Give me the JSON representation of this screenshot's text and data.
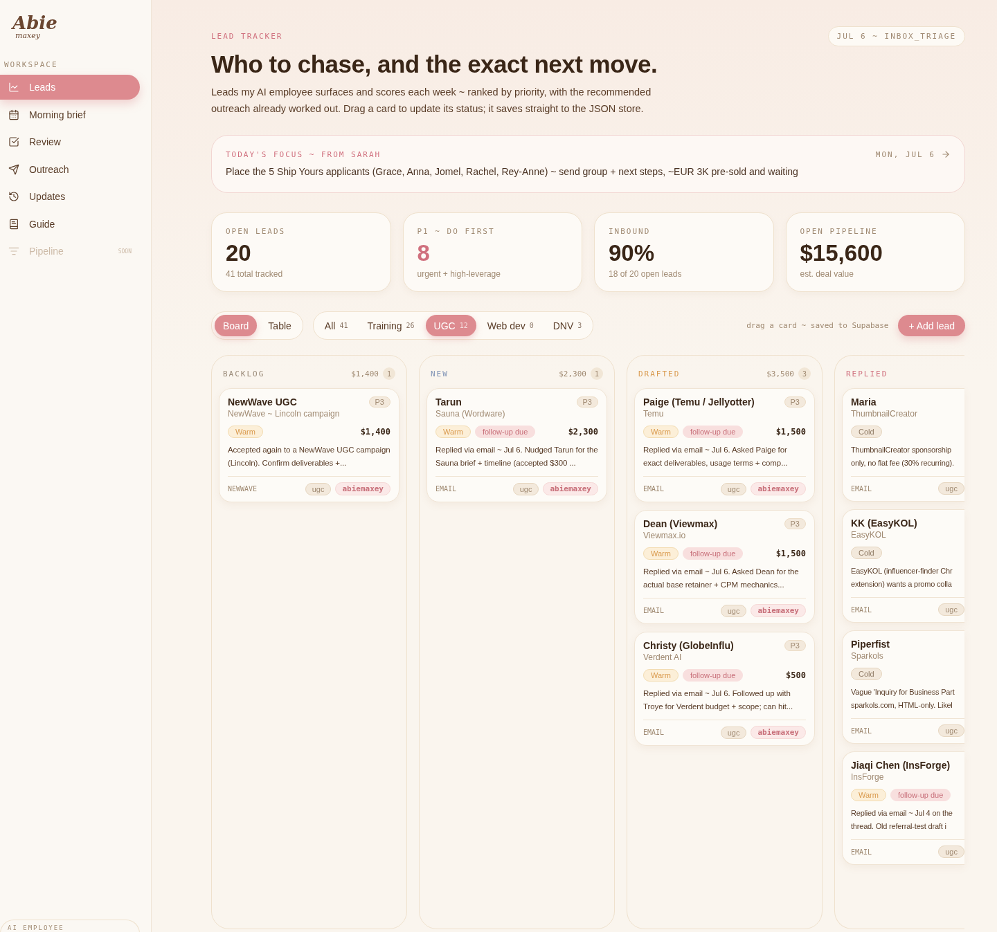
{
  "logo": {
    "title": "Abie",
    "subtitle": "maxey"
  },
  "sidebar": {
    "section": "WORKSPACE",
    "items": [
      {
        "label": "Leads",
        "selected": true,
        "disabled": false
      },
      {
        "label": "Morning brief",
        "selected": false,
        "disabled": false
      },
      {
        "label": "Review",
        "selected": false,
        "disabled": false
      },
      {
        "label": "Outreach",
        "selected": false,
        "disabled": false
      },
      {
        "label": "Updates",
        "selected": false,
        "disabled": false
      },
      {
        "label": "Guide",
        "selected": false,
        "disabled": false
      },
      {
        "label": "Pipeline",
        "selected": false,
        "disabled": true,
        "badge": "SOON"
      }
    ],
    "footer": "AI EMPLOYEE"
  },
  "header": {
    "eyebrow": "LEAD TRACKER",
    "title": "Who to chase, and the exact next move.",
    "intro": "Leads my AI employee surfaces and scores each week ~ ranked by priority, with the recommended outreach already worked out. Drag a card to update its status; it saves straight to the JSON store.",
    "run_tag": "JUL 6 ~ INBOX_TRIAGE"
  },
  "focus": {
    "label": "TODAY'S FOCUS ~ FROM SARAH",
    "date": "MON, JUL 6",
    "text": "Place the 5 Ship Yours applicants (Grace, Anna, Jomel, Rachel, Rey-Anne) ~ send group + next steps, ~EUR 3K pre-sold and waiting"
  },
  "stats": [
    {
      "label": "OPEN LEADS",
      "value": "20",
      "note": "41 total tracked",
      "accent": false
    },
    {
      "label": "P1 ~ DO FIRST",
      "value": "8",
      "note": "urgent + high-leverage",
      "accent": true
    },
    {
      "label": "INBOUND",
      "value": "90%",
      "note": "18 of 20 open leads",
      "accent": false
    },
    {
      "label": "OPEN PIPELINE",
      "value": "$15,600",
      "note": "est. deal value",
      "accent": false
    }
  ],
  "views": [
    {
      "label": "Board",
      "selected": true
    },
    {
      "label": "Table",
      "selected": false
    }
  ],
  "filters": [
    {
      "label": "All",
      "count": "41",
      "selected": false
    },
    {
      "label": "Training",
      "count": "26",
      "selected": false
    },
    {
      "label": "UGC",
      "count": "12",
      "selected": true
    },
    {
      "label": "Web dev",
      "count": "0",
      "selected": false
    },
    {
      "label": "DNV",
      "count": "3",
      "selected": false
    }
  ],
  "hint": "drag a card ~ saved to Supabase",
  "add_button": "+ Add lead",
  "columns": [
    {
      "title": "BACKLOG",
      "color": "#9a8a78",
      "total": "$1,400",
      "count": "1",
      "cards": [
        {
          "name": "NewWave UGC",
          "company": "NewWave ~ Lincoln campaign",
          "priority": "P3",
          "tags": [
            {
              "label": "Warm",
              "kind": "warm"
            }
          ],
          "amount": "$1,400",
          "summary": "Accepted again to a NewWave UGC campaign (Lincoln). Confirm deliverables +...",
          "source": "NEWWAVE",
          "labels": [
            {
              "label": "ugc",
              "kind": "plain"
            },
            {
              "label": "abiemaxey",
              "kind": "owner"
            }
          ]
        }
      ]
    },
    {
      "title": "NEW",
      "color": "#7f93b5",
      "total": "$2,300",
      "count": "1",
      "cards": [
        {
          "name": "Tarun",
          "company": "Sauna (Wordware)",
          "priority": "P3",
          "tags": [
            {
              "label": "Warm",
              "kind": "warm"
            },
            {
              "label": "follow-up due",
              "kind": "due"
            }
          ],
          "amount": "$2,300",
          "summary": "Replied via email ~ Jul 6. Nudged Tarun for the Sauna brief + timeline (accepted $300 ...",
          "source": "EMAIL",
          "labels": [
            {
              "label": "ugc",
              "kind": "plain"
            },
            {
              "label": "abiemaxey",
              "kind": "owner"
            }
          ]
        }
      ]
    },
    {
      "title": "DRAFTED",
      "color": "#d99a4e",
      "total": "$3,500",
      "count": "3",
      "cards": [
        {
          "name": "Paige (Temu / Jellyotter)",
          "company": "Temu",
          "priority": "P3",
          "tags": [
            {
              "label": "Warm",
              "kind": "warm"
            },
            {
              "label": "follow-up due",
              "kind": "due"
            }
          ],
          "amount": "$1,500",
          "summary": "Replied via email ~ Jul 6. Asked Paige for exact deliverables, usage terms + comp...",
          "source": "EMAIL",
          "labels": [
            {
              "label": "ugc",
              "kind": "plain"
            },
            {
              "label": "abiemaxey",
              "kind": "owner"
            }
          ]
        },
        {
          "name": "Dean (Viewmax)",
          "company": "Viewmax.io",
          "priority": "P3",
          "tags": [
            {
              "label": "Warm",
              "kind": "warm"
            },
            {
              "label": "follow-up due",
              "kind": "due"
            }
          ],
          "amount": "$1,500",
          "summary": "Replied via email ~ Jul 6. Asked Dean for the actual base retainer + CPM mechanics...",
          "source": "EMAIL",
          "labels": [
            {
              "label": "ugc",
              "kind": "plain"
            },
            {
              "label": "abiemaxey",
              "kind": "owner"
            }
          ]
        },
        {
          "name": "Christy (GlobeInflu)",
          "company": "Verdent AI",
          "priority": "P3",
          "tags": [
            {
              "label": "Warm",
              "kind": "warm"
            },
            {
              "label": "follow-up due",
              "kind": "due"
            }
          ],
          "amount": "$500",
          "summary": "Replied via email ~ Jul 6. Followed up with Troye for Verdent budget + scope; can hit...",
          "source": "EMAIL",
          "labels": [
            {
              "label": "ugc",
              "kind": "plain"
            },
            {
              "label": "abiemaxey",
              "kind": "owner"
            }
          ]
        }
      ]
    },
    {
      "title": "REPLIED",
      "color": "#d0707e",
      "cards": [
        {
          "name": "Maria",
          "company": "ThumbnailCreator",
          "tags": [
            {
              "label": "Cold",
              "kind": "cold"
            }
          ],
          "summary": "ThumbnailCreator sponsorship only, no flat fee (30% recurring).",
          "source": "EMAIL",
          "labels": [
            {
              "label": "ugc",
              "kind": "plain"
            }
          ]
        },
        {
          "name": "KK (EasyKOL)",
          "company": "EasyKOL",
          "tags": [
            {
              "label": "Cold",
              "kind": "cold"
            }
          ],
          "summary": "EasyKOL (influencer-finder Chr extension) wants a promo colla",
          "source": "EMAIL",
          "labels": [
            {
              "label": "ugc",
              "kind": "plain"
            }
          ]
        },
        {
          "name": "Piperfist",
          "company": "Sparkols",
          "tags": [
            {
              "label": "Cold",
              "kind": "cold"
            }
          ],
          "summary": "Vague 'Inquiry for Business Part sparkols.com, HTML-only. Likel",
          "source": "EMAIL",
          "labels": [
            {
              "label": "ugc",
              "kind": "plain"
            }
          ]
        },
        {
          "name": "Jiaqi Chen (InsForge)",
          "company": "InsForge",
          "tags": [
            {
              "label": "Warm",
              "kind": "warm"
            },
            {
              "label": "follow-up due",
              "kind": "due"
            }
          ],
          "summary": "Replied via email ~ Jul 4 on the thread. Old referral-test draft i",
          "source": "EMAIL",
          "labels": [
            {
              "label": "ugc",
              "kind": "plain"
            }
          ]
        }
      ]
    }
  ]
}
